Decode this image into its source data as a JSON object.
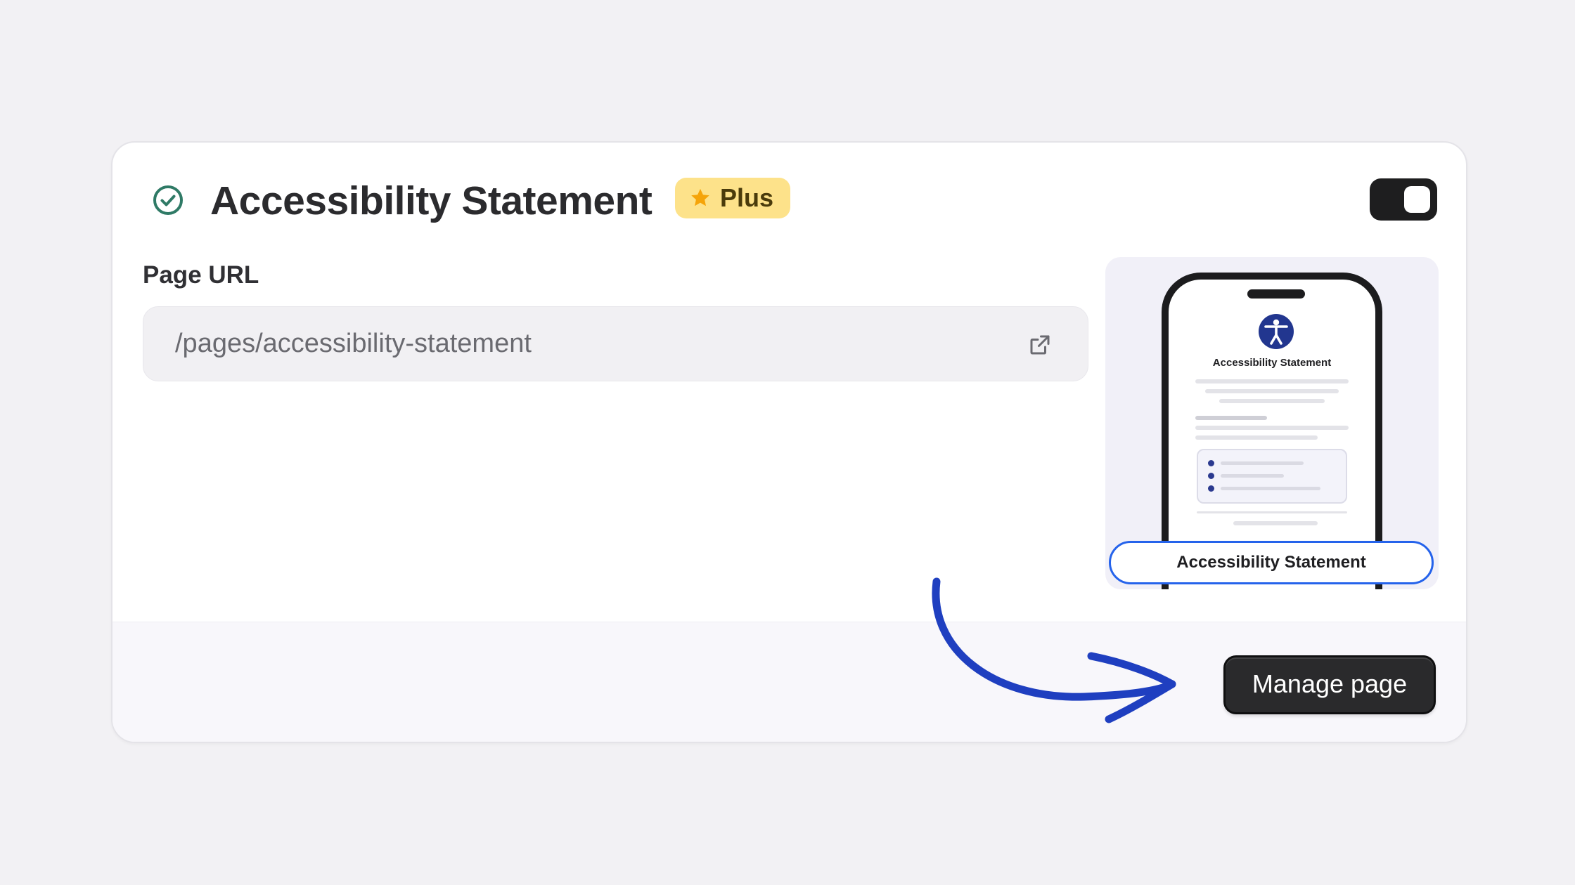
{
  "feature": {
    "title": "Accessibility Statement",
    "badge": {
      "label": "Plus",
      "icon": "star-icon",
      "color": "#fde28a"
    },
    "status_icon": "check-circle-icon",
    "status_color": "#2f7a66",
    "toggle": {
      "state": "on"
    }
  },
  "page_url": {
    "label": "Page URL",
    "value": "/pages/accessibility-statement",
    "action_icon": "external-link-icon"
  },
  "preview": {
    "phone_title": "Accessibility Statement",
    "pill_label": "Accessibility Statement",
    "logo_icon": "accessibility-person-icon",
    "accent_color": "#2563eb"
  },
  "annotation": {
    "icon": "curved-arrow-icon",
    "color": "#1f3fc0"
  },
  "footer": {
    "button_label": "Manage page"
  }
}
